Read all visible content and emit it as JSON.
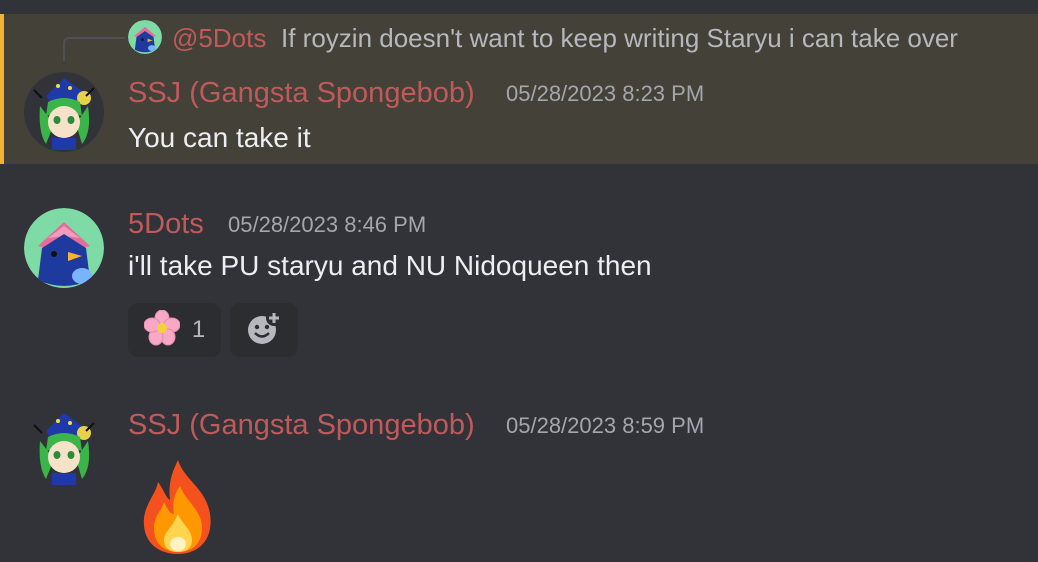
{
  "reply": {
    "author": "@5Dots",
    "text": "If royzin doesn't want to keep writing Staryu i can take over"
  },
  "messages": [
    {
      "author": "SSJ (Gangsta Spongebob)",
      "timestamp": "05/28/2023 8:23 PM",
      "content": "You can take it",
      "highlighted": true
    },
    {
      "author": "5Dots",
      "timestamp": "05/28/2023 8:46 PM",
      "content": "i'll take PU staryu and NU Nidoqueen then",
      "reactions": [
        {
          "emoji": "cherry-blossom",
          "count": "1"
        }
      ]
    },
    {
      "author": "SSJ (Gangsta Spongebob)",
      "timestamp": "05/28/2023 8:59 PM",
      "content_emoji": "fire"
    }
  ],
  "colors": {
    "background": "#313338",
    "highlight": "#444138",
    "highlight_bar": "#f0b232",
    "author": "#c05a5a"
  }
}
